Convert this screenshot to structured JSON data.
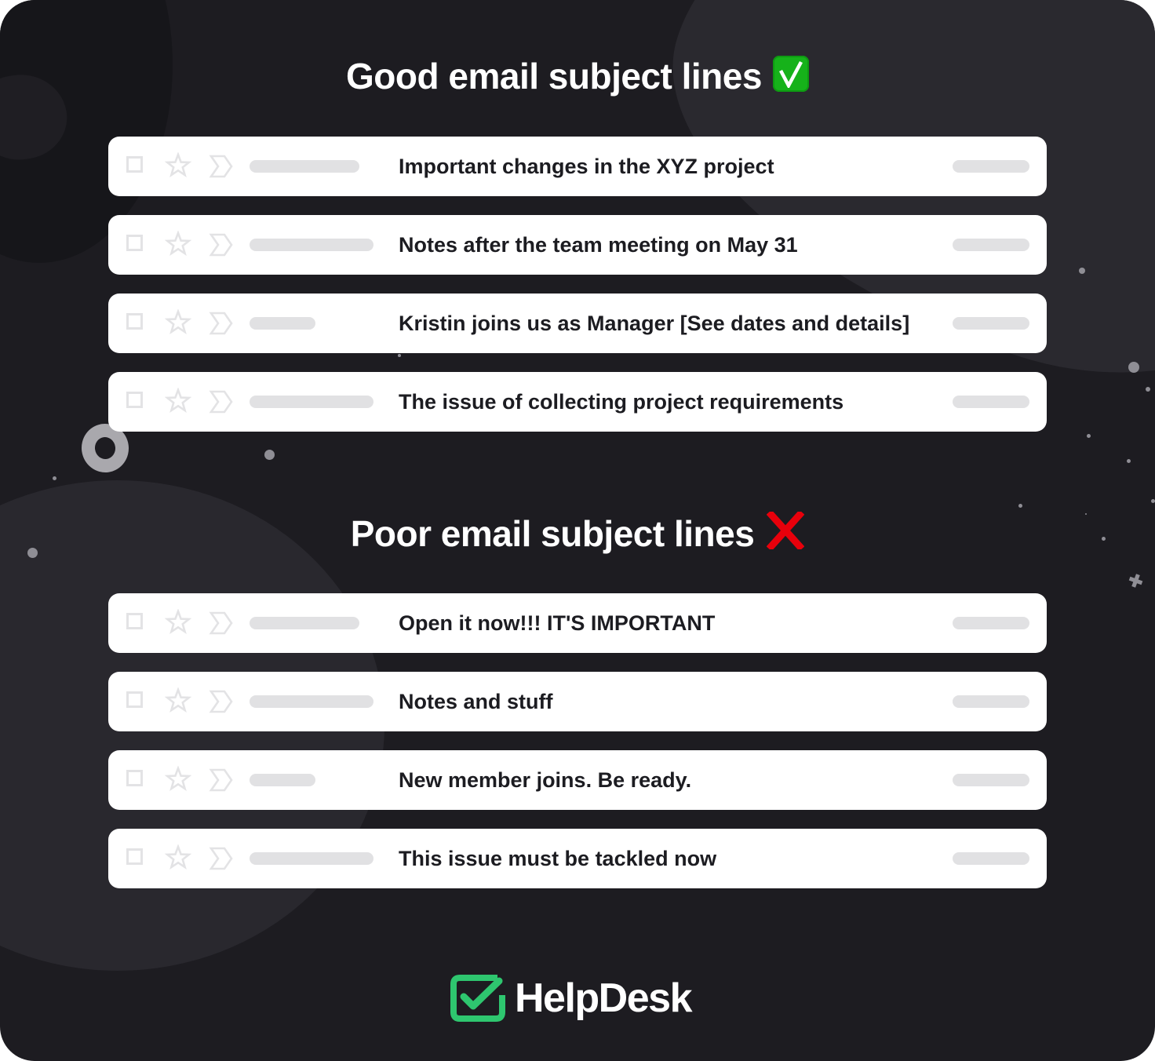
{
  "good_section": {
    "title": "Good email subject lines",
    "badge_icon": "check-mark-button-icon",
    "badge_color": "#16b21a",
    "emails": [
      {
        "subject": "Important changes in the XYZ project",
        "pill": "medium"
      },
      {
        "subject": "Notes after the team meeting on May 31",
        "pill": "long"
      },
      {
        "subject": "Kristin joins us as Manager [See dates and details]",
        "pill": "short"
      },
      {
        "subject": "The issue of collecting project requirements",
        "pill": "long"
      }
    ]
  },
  "poor_section": {
    "title": "Poor email subject lines",
    "badge_icon": "cross-mark-icon",
    "badge_color": "#e8000b",
    "emails": [
      {
        "subject": "Open it now!!! IT'S IMPORTANT",
        "pill": "medium"
      },
      {
        "subject": "Notes and stuff",
        "pill": "long"
      },
      {
        "subject": "New member joins. Be ready.",
        "pill": "short"
      },
      {
        "subject": "This issue must be tackled now",
        "pill": "long"
      }
    ]
  },
  "row_icons": [
    "checkbox-icon",
    "star-icon",
    "label-icon"
  ],
  "brand": {
    "name": "HelpDesk",
    "accent_color": "#2ec66f"
  }
}
